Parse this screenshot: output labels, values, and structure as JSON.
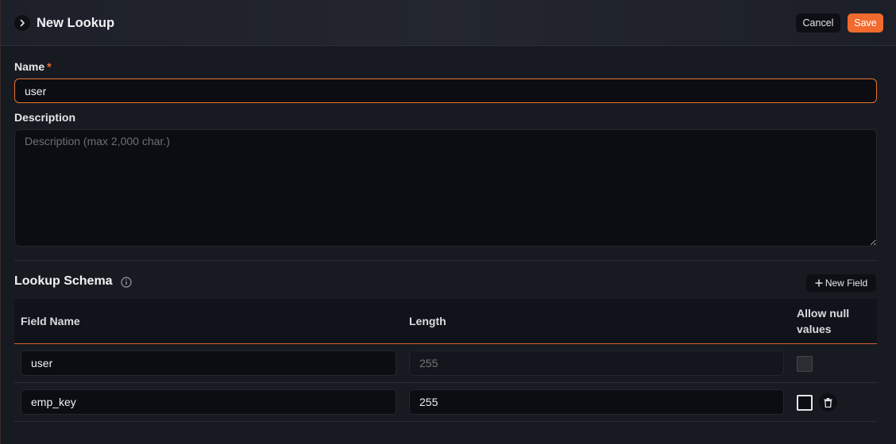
{
  "header": {
    "title": "New Lookup",
    "toggle_icon": "chevron-right-icon",
    "cancel_label": "Cancel",
    "save_label": "Save"
  },
  "form": {
    "name_label": "Name",
    "name_required_mark": "*",
    "name_value": "user",
    "description_label": "Description",
    "description_value": "",
    "description_placeholder": "Description (max 2,000 char.)"
  },
  "schema": {
    "title": "Lookup Schema",
    "info_icon": "info-icon",
    "new_field_label": "New Field",
    "columns": {
      "field_name": "Field Name",
      "length": "Length",
      "allow_null_line1": "Allow null",
      "allow_null_line2": "values"
    },
    "rows": [
      {
        "field_name": "user",
        "length": "",
        "length_placeholder": "255",
        "allow_null": false,
        "disabled": true
      },
      {
        "field_name": "emp_key",
        "length": "255",
        "length_placeholder": "",
        "allow_null": false,
        "disabled": false,
        "delete_icon": "trash-icon"
      }
    ]
  },
  "colors": {
    "accent": "#f26b2e",
    "background": "#181a21",
    "input_bg": "#0b0d12"
  }
}
